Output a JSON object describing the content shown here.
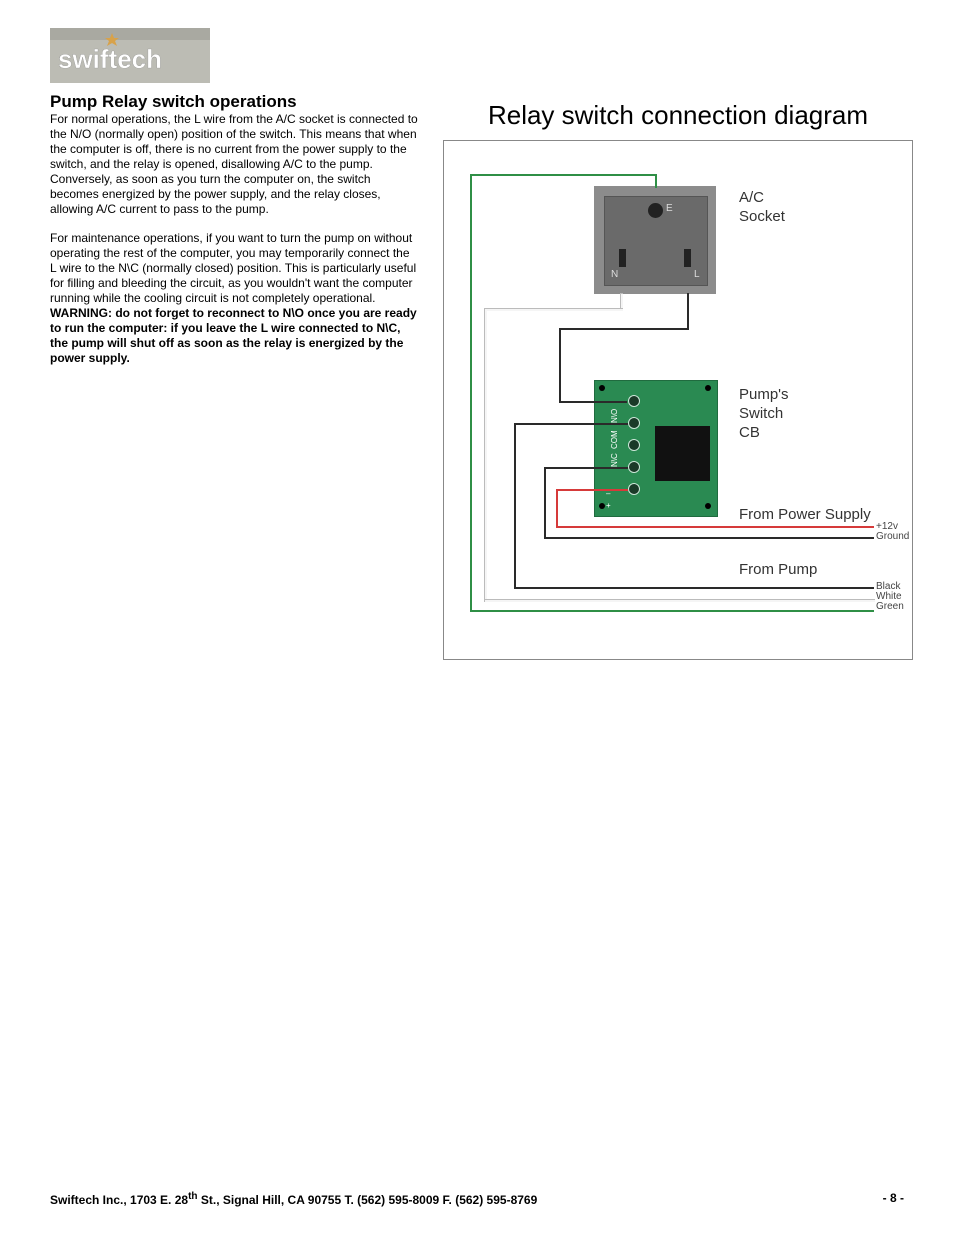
{
  "logo_text": "swiftech",
  "section_title": "Pump Relay switch operations",
  "para1": "For normal operations, the L wire from the A/C socket is connected to the N/O (normally open) position of the switch. This means that when the computer is off, there is no current from the power supply to the switch, and the relay is opened, disallowing A/C to the pump.  Conversely, as soon as you turn the computer on,  the switch becomes energized by the power supply, and the relay closes, allowing A/C current to pass to the pump.",
  "para2_plain": "For maintenance operations, if you want to turn the pump on without operating the rest of the computer, you may temporarily connect the L wire to the N\\C (normally  closed) position. This is particularly useful for filling and bleeding the circuit, as you wouldn't want the computer running while the cooling circuit is not completely operational. ",
  "para2_warning": "WARNING: do not forget to reconnect to N\\O once you are ready to run the computer: if you leave the L wire connected to N\\C, the pump will shut off as soon as the relay is energized by the power supply.",
  "diagram_title": "Relay switch connection diagram",
  "labels": {
    "ac_socket_l1": "A/C",
    "ac_socket_l2": "Socket",
    "pump_switch_l1": "Pump's",
    "pump_switch_l2": "Switch",
    "pump_switch_l3": "CB",
    "from_psu": "From Power Supply",
    "from_pump": "From Pump",
    "psu_12v": "+12v",
    "psu_gnd": "Ground",
    "pump_black": "Black",
    "pump_white": "White",
    "pump_green": "Green"
  },
  "terminals": {
    "e": "E",
    "n": "N",
    "l": "L",
    "no": "N\\O",
    "com": "COM",
    "nc": "N\\C",
    "minus": "–",
    "plus": "+"
  },
  "footer_left": "Swiftech Inc., 1703 E. 28",
  "footer_left_sup": "th",
  "footer_left_rest": " St., Signal Hill, CA 90755 T. (562) 595-8009 F. (562) 595-8769",
  "footer_right": "- 8 -"
}
